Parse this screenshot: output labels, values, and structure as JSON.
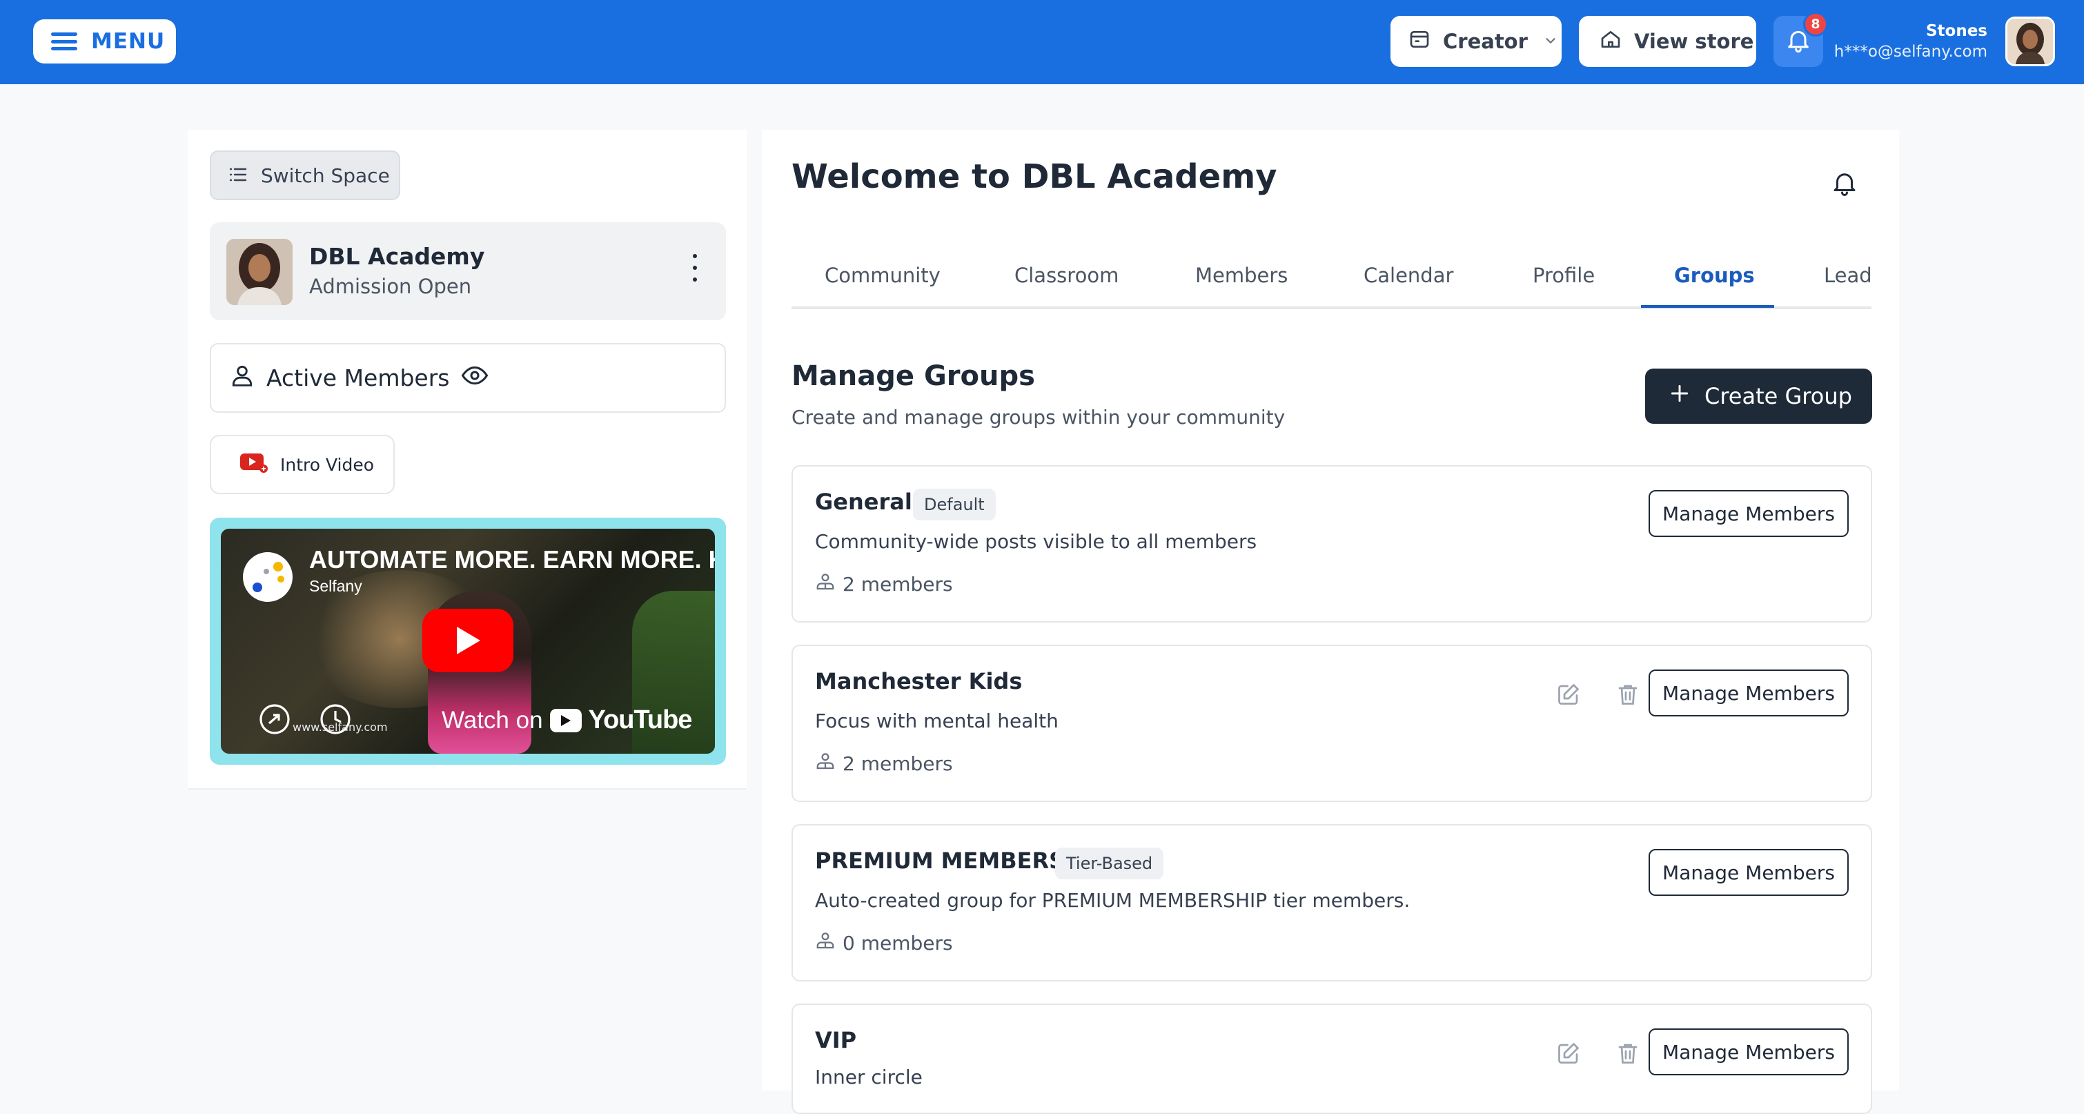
{
  "topbar": {
    "menu_label": "MENU",
    "creator_label": "Creator",
    "view_store_label": "View store",
    "notification_count": "8",
    "user_name": "Stones",
    "user_email": "h***o@selfany.com"
  },
  "sidebar": {
    "switch_space_label": "Switch Space",
    "space_name": "DBL Academy",
    "space_status": "Admission Open",
    "active_members_label": "Active Members",
    "intro_video_label": "Intro Video",
    "video": {
      "title": "AUTOMATE MORE. EARN MORE. K",
      "channel": "Selfany",
      "watch_on": "Watch on",
      "youtube": "YouTube",
      "url": "www.selfany.com"
    }
  },
  "main": {
    "title": "Welcome to DBL Academy",
    "tabs": [
      {
        "label": "Community"
      },
      {
        "label": "Classroom"
      },
      {
        "label": "Members"
      },
      {
        "label": "Calendar"
      },
      {
        "label": "Profile"
      },
      {
        "label": "Groups",
        "active": true
      },
      {
        "label": "Lead"
      }
    ],
    "section_title": "Manage Groups",
    "section_subtitle": "Create and manage groups within your community",
    "create_group_label": "Create Group",
    "groups": [
      {
        "name": "General",
        "badge": "Default",
        "description": "Community-wide posts visible to all members",
        "members": "2 members",
        "manage_label": "Manage Members",
        "editable": false
      },
      {
        "name": "Manchester Kids",
        "badge": "",
        "description": "Focus with mental health",
        "members": "2 members",
        "manage_label": "Manage Members",
        "editable": true
      },
      {
        "name": "PREMIUM MEMBERSHIP",
        "badge": "Tier-Based",
        "description": "Auto-created group for PREMIUM MEMBERSHIP tier members.",
        "members": "0 members",
        "manage_label": "Manage Members",
        "editable": false
      },
      {
        "name": "VIP",
        "badge": "",
        "description": "Inner circle",
        "members": "",
        "manage_label": "Manage Members",
        "editable": true
      }
    ]
  },
  "colors": {
    "brand_blue": "#1a6fe0",
    "active_tab": "#1a5bbd",
    "dark_button": "#1e2a38",
    "video_border": "#8ee3ec",
    "notification_red": "#ef4444"
  },
  "icons": [
    "hamburger-icon",
    "store-icon",
    "chevron-down-icon",
    "home-icon",
    "bell-icon",
    "list-icon",
    "kebab-icon",
    "users-icon",
    "eye-icon",
    "youtube-icon",
    "play-icon",
    "plus-icon",
    "members-icon",
    "edit-icon",
    "trash-icon"
  ]
}
